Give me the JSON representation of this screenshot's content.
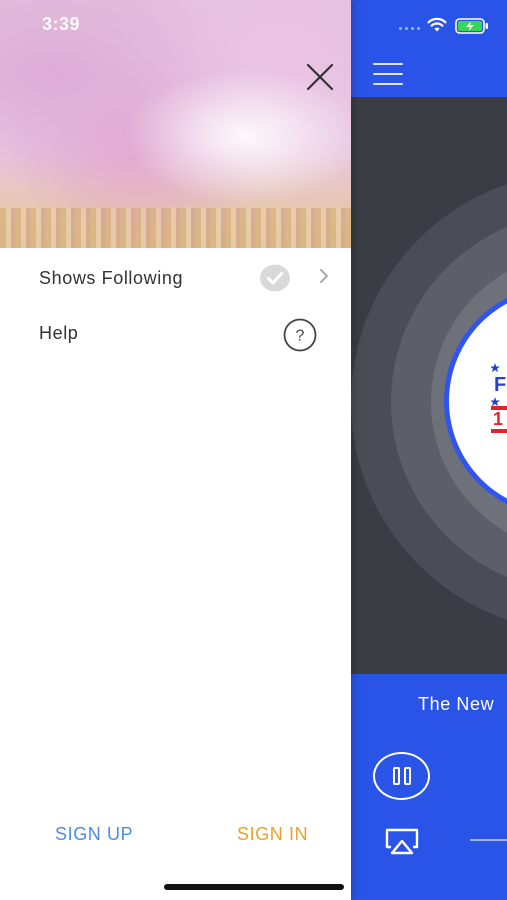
{
  "status_bar": {
    "time": "3:39"
  },
  "drawer": {
    "menu_items": [
      {
        "label": "Shows Following",
        "icon": "check-circle-icon",
        "has_chevron": true
      },
      {
        "label": "Help",
        "icon": "help-circle-icon"
      }
    ],
    "footer": {
      "sign_up_label": "SIGN UP",
      "sign_in_label": "SIGN IN"
    },
    "colors": {
      "sign_up": "#4a8fdf",
      "sign_in": "#e8a12c"
    }
  },
  "player": {
    "now_playing_title": "The New",
    "logo_text_line1": "F",
    "logo_text_line2": "1",
    "colors": {
      "accent": "#2a54e8",
      "art_background": "#3a3d44"
    }
  }
}
